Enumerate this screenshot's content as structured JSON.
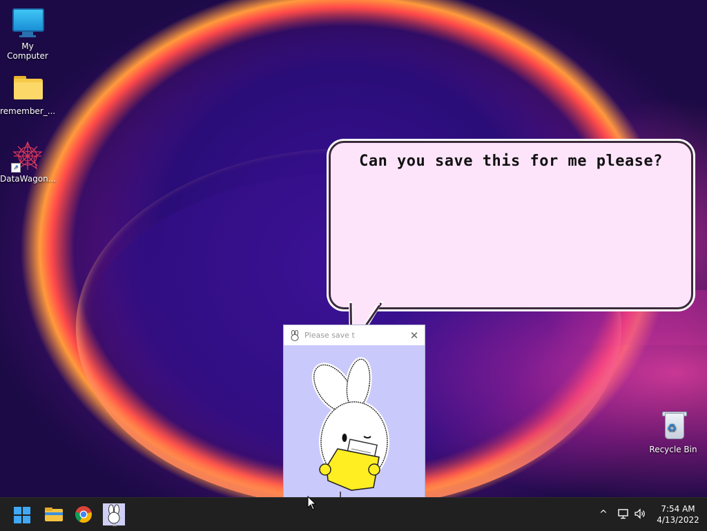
{
  "desktop": {
    "icons": [
      {
        "label": "My Computer",
        "icon": "monitor-icon"
      },
      {
        "label": "remember_...",
        "icon": "folder-icon"
      },
      {
        "label": "DataWagon...",
        "icon": "datawagon-app-icon"
      },
      {
        "label": "Recycle Bin",
        "icon": "recycle-bin-icon"
      }
    ]
  },
  "bubble": {
    "text": "Can you save this for me please?"
  },
  "app_window": {
    "title": "Please save t",
    "close_glyph": "✕"
  },
  "taskbar": {
    "apps": [
      {
        "name": "Start",
        "icon": "windows-start-icon"
      },
      {
        "name": "File Explorer",
        "icon": "file-explorer-icon"
      },
      {
        "name": "Google Chrome",
        "icon": "chrome-icon"
      },
      {
        "name": "Bunny app",
        "icon": "bunny-app-icon"
      }
    ],
    "tray": {
      "chevron": "^",
      "time": "7:54 AM",
      "date": "4/13/2022"
    }
  },
  "colors": {
    "bubble_bg": "#fde4fb",
    "app_bg": "#cac9fb",
    "taskbar_bg": "#202020"
  }
}
